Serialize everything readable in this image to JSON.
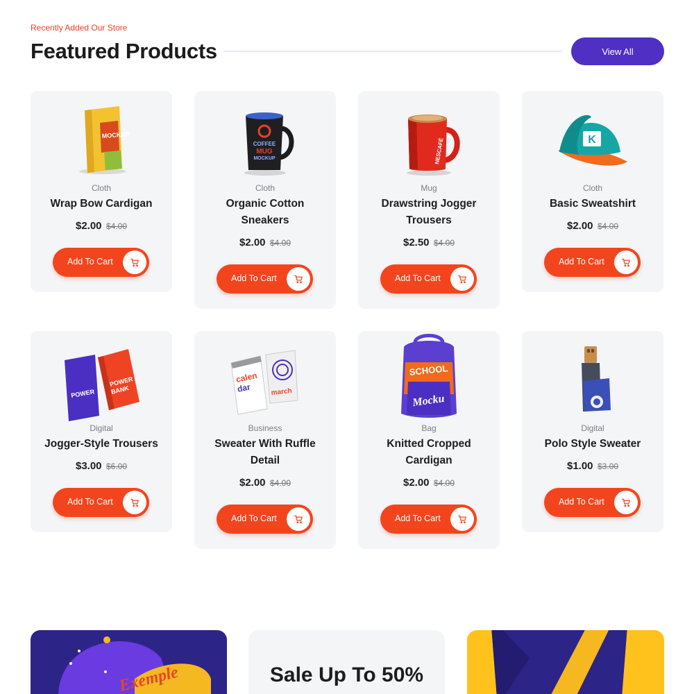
{
  "section": {
    "eyebrow": "Recently Added Our Store",
    "title": "Featured Products",
    "view_all_label": "View All"
  },
  "cart_label": "Add To Cart",
  "products": [
    {
      "category": "Cloth",
      "name": "Wrap Bow Cardigan",
      "price": "$2.00",
      "old_price": "$4.00",
      "image": "coffee-pouch-mockup"
    },
    {
      "category": "Cloth",
      "name": "Organic Cotton Sneakers",
      "price": "$2.00",
      "old_price": "$4.00",
      "image": "black-coffee-mug"
    },
    {
      "category": "Mug",
      "name": "Drawstring Jogger Trousers",
      "price": "$2.50",
      "old_price": "$4.00",
      "image": "red-nescafe-mug"
    },
    {
      "category": "Cloth",
      "name": "Basic Sweatshirt",
      "price": "$2.00",
      "old_price": "$4.00",
      "image": "teal-snapback-cap"
    },
    {
      "category": "Digital",
      "name": "Jogger-Style Trousers",
      "price": "$3.00",
      "old_price": "$6.00",
      "image": "power-bank-boxes"
    },
    {
      "category": "Business",
      "name": "Sweater With Ruffle Detail",
      "price": "$2.00",
      "old_price": "$4.00",
      "image": "desk-calendars"
    },
    {
      "category": "Bag",
      "name": "Knitted Cropped Cardigan",
      "price": "$2.00",
      "old_price": "$4.00",
      "image": "school-backpack"
    },
    {
      "category": "Digital",
      "name": "Polo Style Sweater",
      "price": "$1.00",
      "old_price": "$3.00",
      "image": "usb-flash-drive"
    }
  ],
  "mug_text": "COFFEE MUG MOCKUP",
  "pouch_text": "MOCKUP",
  "nescafe_text": "NESCAFÉ",
  "cap_text": "K",
  "powerbank_text": "POWER BANK",
  "calendar_text": "calen dar",
  "calendar_text2": "march",
  "backpack_text": "SCHOOL",
  "promo": {
    "sale_title": "Sale Up To 50%",
    "cap_script": "Exemple"
  },
  "colors": {
    "accent_red": "#f2451e",
    "brand_purple": "#4f2fc4",
    "card_bg": "#f4f5f7"
  }
}
